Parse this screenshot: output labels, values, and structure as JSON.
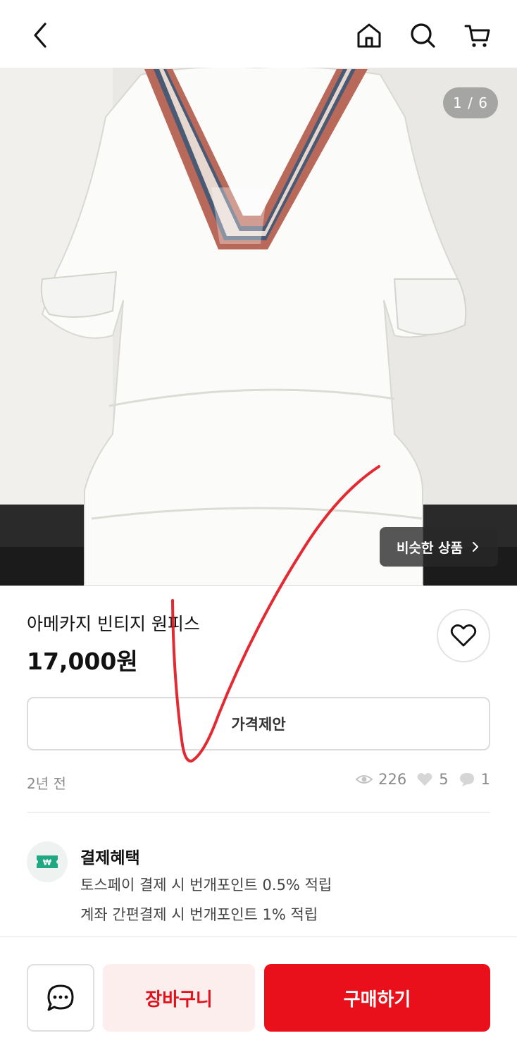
{
  "header": {
    "back_icon": "chevron-left-icon",
    "home_icon": "home-icon",
    "search_icon": "search-icon",
    "cart_icon": "cart-icon"
  },
  "gallery": {
    "counter": "1 / 6",
    "similar_label": "비슷한 상품",
    "similar_icon": "chevron-right-icon"
  },
  "product": {
    "title": "아메카지 빈티지 원피스",
    "price": "17,000원",
    "offer_label": "가격제안",
    "posted": "2년 전",
    "views": "226",
    "likes": "5",
    "chats": "1"
  },
  "benefit": {
    "title": "결제혜택",
    "line1": "토스페이 결제 시 번개포인트 0.5% 적립",
    "line2": "계좌 간편결제 시 번개포인트 1% 적립"
  },
  "actions": {
    "cart_label": "장바구니",
    "buy_label": "구매하기"
  },
  "colors": {
    "accent": "#e9101c",
    "cart_bg": "#fdeeee",
    "benefit_icon": "#1fa882"
  }
}
